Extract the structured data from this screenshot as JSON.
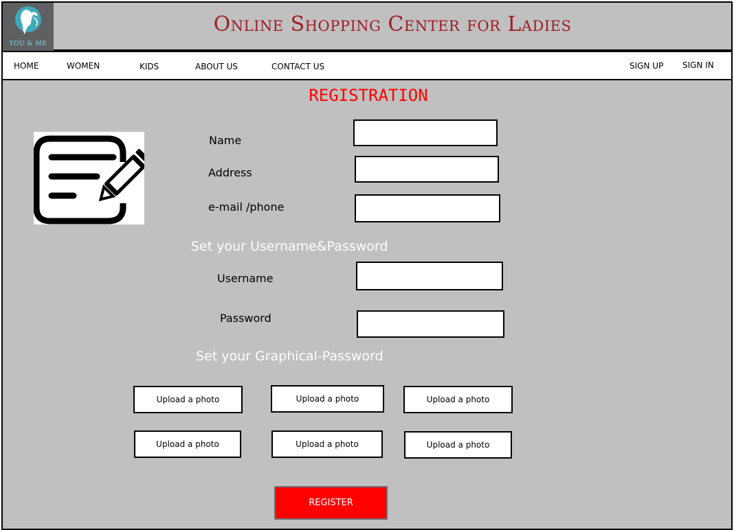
{
  "header": {
    "logo_text": "YOU & ME",
    "title": "Online Shopping Center for Ladies"
  },
  "nav": {
    "items": [
      {
        "label": "HOME"
      },
      {
        "label": "WOMEN"
      },
      {
        "label": "KIDS"
      },
      {
        "label": "ABOUT US"
      },
      {
        "label": "CONTACT US"
      }
    ],
    "sign_up": "SIGN UP",
    "sign_in": "SIGN IN"
  },
  "form": {
    "title": "REGISTRATION",
    "labels": {
      "name": "Name",
      "address": "Address",
      "email_phone": "e-mail /phone",
      "username": "Username",
      "password": "Password"
    },
    "credentials_heading": "Set your Username&Password",
    "graphical_heading": "Set your Graphical-Password",
    "upload_buttons": [
      "Upload a photo",
      "Upload a photo",
      "Upload a photo",
      "Upload a photo",
      "Upload a photo",
      "Upload a photo"
    ],
    "register_label": "REGISTER"
  },
  "icons": {
    "logo": "woman-silhouette-logo-icon",
    "form": "document-edit-icon"
  },
  "colors": {
    "title_red": "#a01c24",
    "registration_red": "#ff0000",
    "background_gray": "#c0c0c0",
    "register_button": "#ff0000"
  }
}
